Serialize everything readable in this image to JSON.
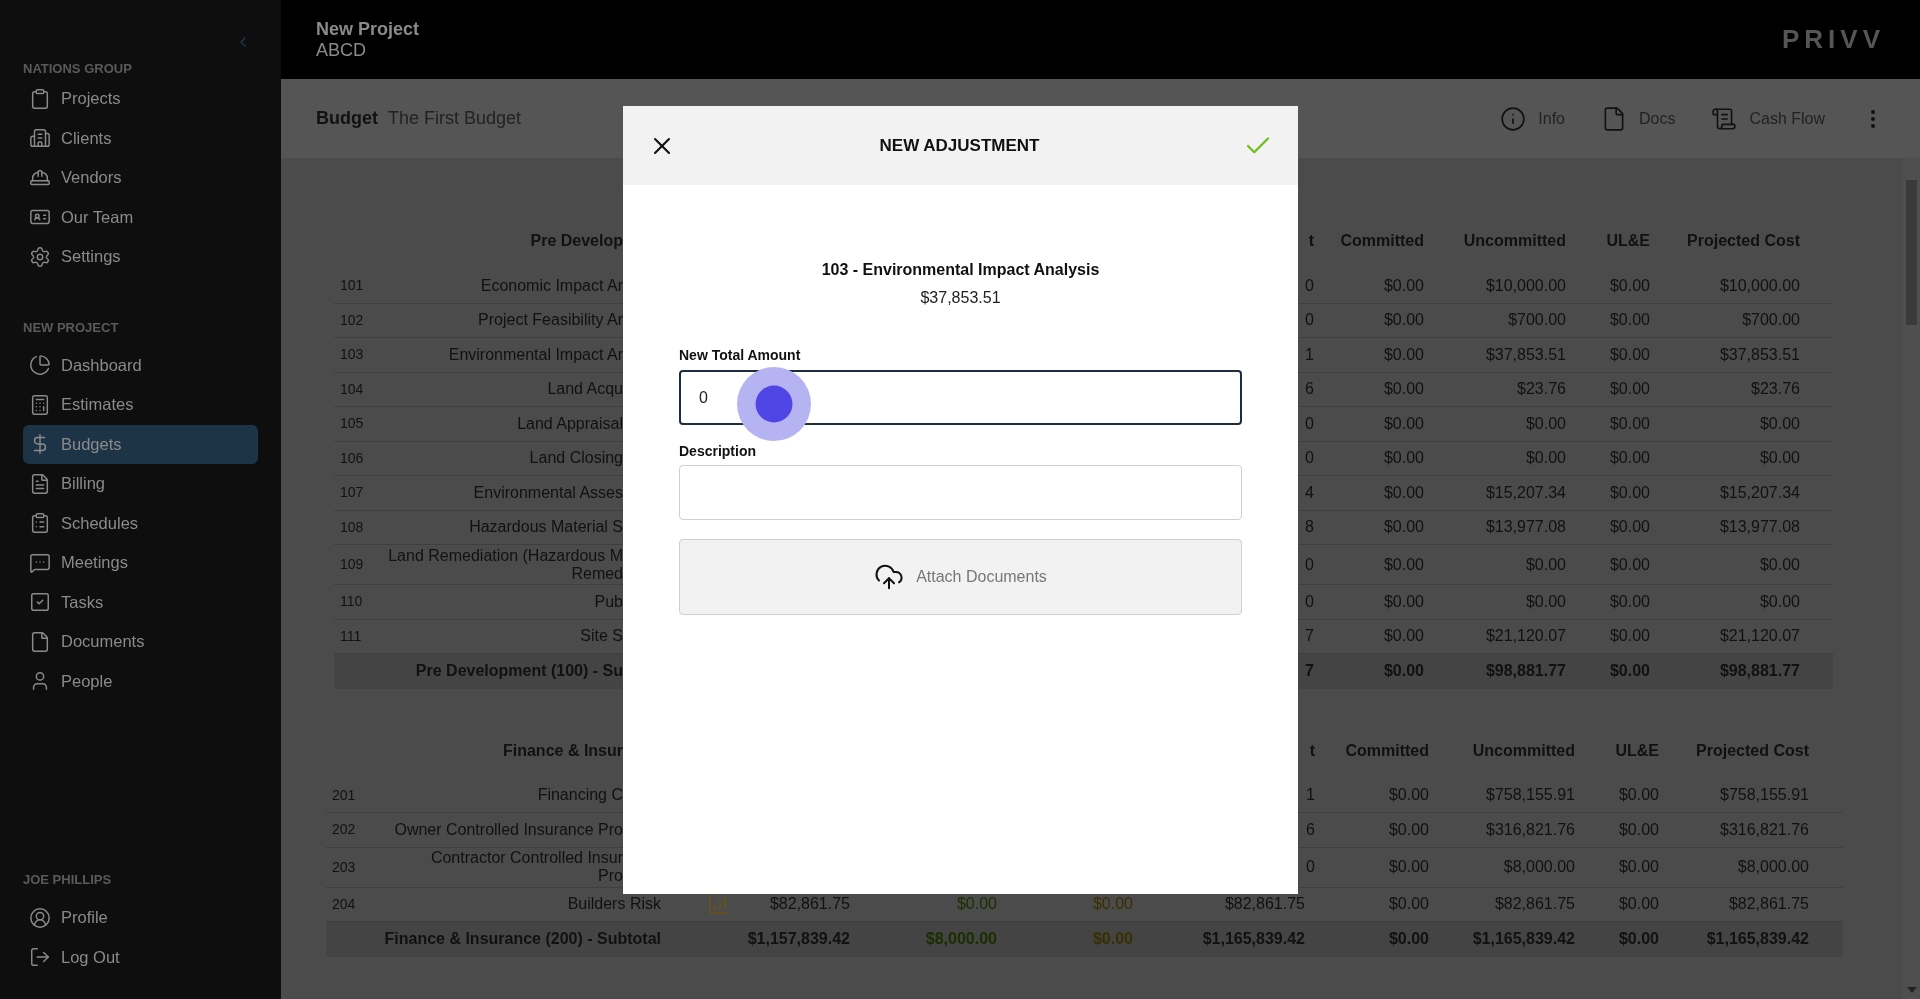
{
  "sidebar": {
    "groups": [
      {
        "label": "NATIONS GROUP",
        "items": [
          {
            "label": "Projects",
            "selected": false
          },
          {
            "label": "Clients",
            "selected": false
          },
          {
            "label": "Vendors",
            "selected": false
          },
          {
            "label": "Our Team",
            "selected": false
          },
          {
            "label": "Settings",
            "selected": false
          }
        ]
      },
      {
        "label": "NEW PROJECT",
        "items": [
          {
            "label": "Dashboard",
            "selected": false
          },
          {
            "label": "Estimates",
            "selected": false
          },
          {
            "label": "Budgets",
            "selected": true
          },
          {
            "label": "Billing",
            "selected": false
          },
          {
            "label": "Schedules",
            "selected": false
          },
          {
            "label": "Meetings",
            "selected": false
          },
          {
            "label": "Tasks",
            "selected": false
          },
          {
            "label": "Documents",
            "selected": false
          },
          {
            "label": "People",
            "selected": false
          }
        ]
      },
      {
        "label": "JOE PHILLIPS",
        "items": [
          {
            "label": "Profile",
            "selected": false
          },
          {
            "label": "Log Out",
            "selected": false
          }
        ]
      }
    ]
  },
  "header": {
    "project": "New Project",
    "code": "ABCD",
    "logo": "PRIVV"
  },
  "toolbar": {
    "label": "Budget",
    "name": "The First Budget",
    "actions": [
      {
        "label": "Info"
      },
      {
        "label": "Docs"
      },
      {
        "label": "Cash Flow"
      }
    ]
  },
  "sections": [
    {
      "header": {
        "description": "Pre Develop",
        "fragment": "t",
        "columns": [
          "Committed",
          "Uncommitted",
          "UL&E",
          "Projected Cost"
        ]
      },
      "rows": [
        {
          "kind": "cut_line",
          "code": "101",
          "description": "Economic Impact Ar",
          "fragment": "0",
          "values": [
            "$0.00",
            "$10,000.00",
            "$0.00",
            "$10,000.00"
          ]
        },
        {
          "kind": "cut_line",
          "code": "102",
          "description": "Project Feasibility Ar",
          "fragment": "0",
          "values": [
            "$0.00",
            "$700.00",
            "$0.00",
            "$700.00"
          ]
        },
        {
          "kind": "cut_line",
          "code": "103",
          "description": "Environmental Impact Ar",
          "fragment": "1",
          "values": [
            "$0.00",
            "$37,853.51",
            "$0.00",
            "$37,853.51"
          ]
        },
        {
          "kind": "cut_line",
          "code": "104",
          "description": "Land Acqu",
          "fragment": "6",
          "values": [
            "$0.00",
            "$23.76",
            "$0.00",
            "$23.76"
          ]
        },
        {
          "kind": "cut_line",
          "code": "105",
          "description": "Land Appraisal",
          "fragment": "0",
          "values": [
            "$0.00",
            "$0.00",
            "$0.00",
            "$0.00"
          ]
        },
        {
          "kind": "cut_line",
          "code": "106",
          "description": "Land Closing",
          "fragment": "0",
          "values": [
            "$0.00",
            "$0.00",
            "$0.00",
            "$0.00"
          ]
        },
        {
          "kind": "cut_line",
          "code": "107",
          "description": "Environmental Asses",
          "fragment": "4",
          "values": [
            "$0.00",
            "$15,207.34",
            "$0.00",
            "$15,207.34"
          ]
        },
        {
          "kind": "cut_line",
          "code": "108",
          "description": "Hazardous Material S",
          "fragment": "8",
          "values": [
            "$0.00",
            "$13,977.08",
            "$0.00",
            "$13,977.08"
          ]
        },
        {
          "kind": "cut_line",
          "code": "109",
          "description": "Land Remediation (Hazardous M\nRemed",
          "fragment": "0",
          "values": [
            "$0.00",
            "$0.00",
            "$0.00",
            "$0.00"
          ]
        },
        {
          "kind": "cut_line",
          "code": "110",
          "description": "Pub",
          "fragment": "0",
          "values": [
            "$0.00",
            "$0.00",
            "$0.00",
            "$0.00"
          ]
        },
        {
          "kind": "cut_line",
          "code": "111",
          "description": "Site S",
          "fragment": "7",
          "values": [
            "$0.00",
            "$21,120.07",
            "$0.00",
            "$21,120.07"
          ]
        },
        {
          "kind": "cut_subtotal",
          "description": "Pre Development (100) - Su",
          "fragment": "7",
          "values": [
            "$0.00",
            "$98,881.77",
            "$0.00",
            "$98,881.77"
          ]
        }
      ]
    },
    {
      "header": {
        "description": "Finance & Insur",
        "fragment": "t",
        "columns": [
          "Committed",
          "Uncommitted",
          "UL&E",
          "Projected Cost"
        ]
      },
      "rows": [
        {
          "kind": "cut_line",
          "code": "201",
          "description": "Financing C",
          "fragment": "1",
          "values": [
            "$0.00",
            "$758,155.91",
            "$0.00",
            "$758,155.91"
          ]
        },
        {
          "kind": "cut_line",
          "code": "202",
          "description": "Owner Controlled Insurance Pro",
          "fragment": "6",
          "values": [
            "$0.00",
            "$316,821.76",
            "$0.00",
            "$316,821.76"
          ]
        },
        {
          "kind": "cut_line",
          "code": "203",
          "description": "Contractor Controlled Insur\nPro",
          "fragment": "0",
          "values": [
            "$0.00",
            "$8,000.00",
            "$0.00",
            "$8,000.00"
          ]
        },
        {
          "kind": "line",
          "code": "204",
          "description": "Builders Risk",
          "values": [
            "$82,861.75",
            "$0.00",
            "$0.00",
            "$82,861.75",
            "$0.00",
            "$82,861.75",
            "$0.00",
            "$82,861.75"
          ]
        },
        {
          "kind": "subtotal",
          "description": "Finance & Insurance (200) - Subtotal",
          "values": [
            "$1,157,839.42",
            "$8,000.00",
            "$0.00",
            "$1,165,839.42",
            "$0.00",
            "$1,165,839.42",
            "$0.00",
            "$1,165,839.42"
          ]
        }
      ]
    }
  ],
  "modal": {
    "title": "NEW ADJUSTMENT",
    "item": "103 - Environmental Impact Analysis",
    "amount": "$37,853.51",
    "fields": [
      {
        "label": "New Total Amount",
        "value": "0",
        "focused": true
      },
      {
        "label": "Description",
        "focused": false
      }
    ],
    "attach": "Attach Documents"
  }
}
